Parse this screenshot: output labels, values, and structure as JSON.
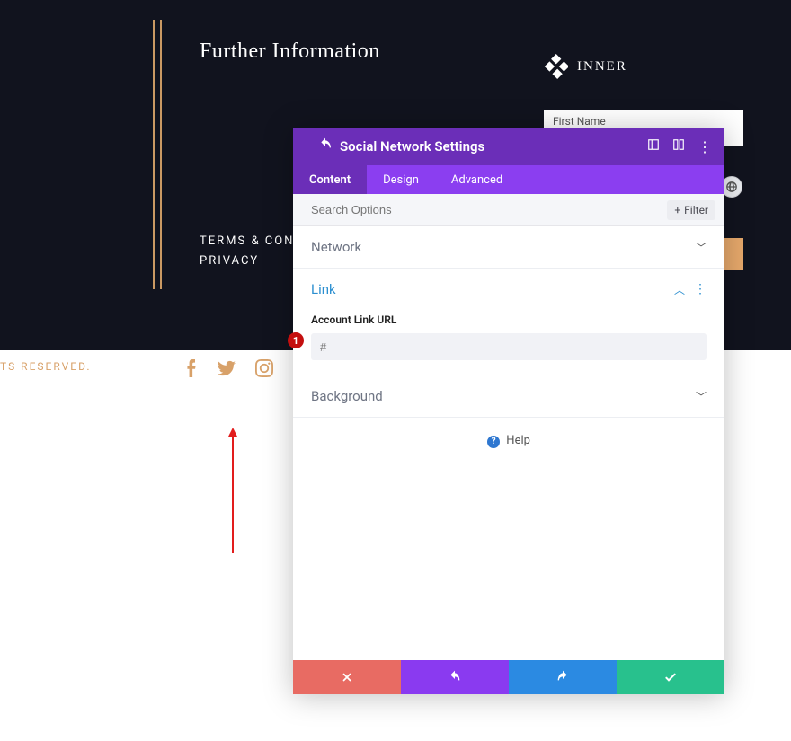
{
  "page": {
    "heading": "Further Information",
    "brand": "INNER",
    "firstname_placeholder": "First Name",
    "links": {
      "terms": "TERMS & CONDITIONS",
      "privacy": "PRIVACY"
    },
    "footer_reserved": "TS RESERVED."
  },
  "modal": {
    "title": "Social Network Settings",
    "tabs": {
      "content": "Content",
      "design": "Design",
      "advanced": "Advanced"
    },
    "search_placeholder": "Search Options",
    "filter_label": "Filter",
    "sections": {
      "network": "Network",
      "link": "Link",
      "background": "Background"
    },
    "link": {
      "field_label": "Account Link URL",
      "value": "#"
    },
    "help_label": "Help",
    "badge": "1"
  }
}
